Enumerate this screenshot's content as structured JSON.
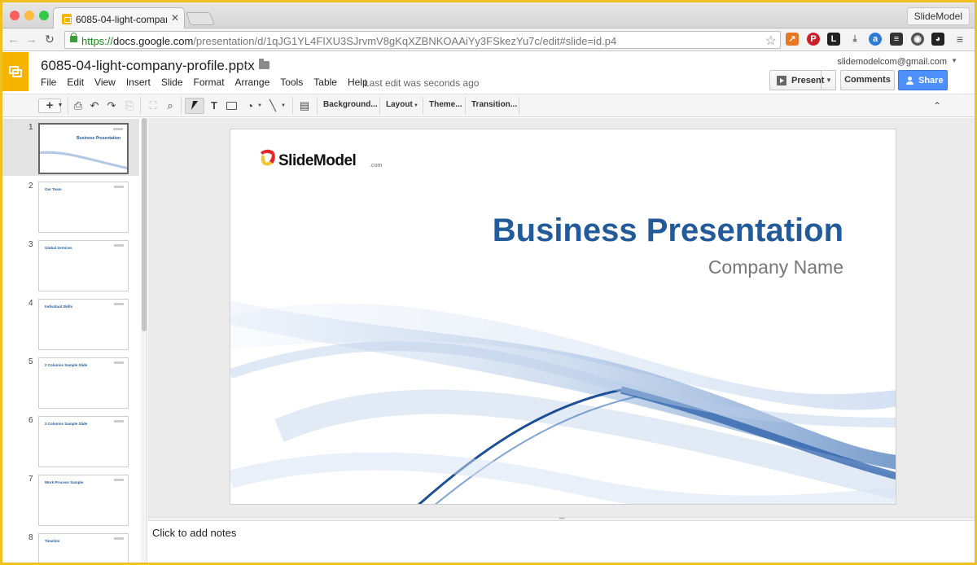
{
  "browser": {
    "tab_title": "6085-04-light-company-pr",
    "profile_name": "SlideModel",
    "url": {
      "scheme": "https://",
      "host": "docs.google.com",
      "path": "/presentation/d/1qJG1YL4FIXU3SJrvmV8gKqXZBNKOAAiYy3FSkezYu7c/edit#slide=id.p4"
    },
    "extensions": [
      "chart-extension-icon",
      "pinterest-icon",
      "l-extension-icon",
      "download-icon",
      "a-extension-icon",
      "buffer-icon",
      "globe-icon",
      "owl-icon",
      "menu-icon"
    ]
  },
  "docs": {
    "file_name": "6085-04-light-company-profile.pptx",
    "account_email": "slidemodelcom@gmail.com",
    "menu": [
      "File",
      "Edit",
      "View",
      "Insert",
      "Slide",
      "Format",
      "Arrange",
      "Tools",
      "Table",
      "Help"
    ],
    "last_edit": "Last edit was seconds ago",
    "present_label": "Present",
    "comments_label": "Comments",
    "share_label": "Share"
  },
  "toolbar": {
    "background_label": "Background...",
    "layout_label": "Layout",
    "theme_label": "Theme...",
    "transition_label": "Transition..."
  },
  "filmstrip": [
    {
      "num": "1",
      "title": "Business Presentation",
      "active": true
    },
    {
      "num": "2",
      "title": "Our Team",
      "active": false
    },
    {
      "num": "3",
      "title": "Global Services",
      "active": false
    },
    {
      "num": "4",
      "title": "Individual Skills",
      "active": false
    },
    {
      "num": "5",
      "title": "2 Columns Sample Slide",
      "active": false
    },
    {
      "num": "6",
      "title": "3 Columns Sample Slide",
      "active": false
    },
    {
      "num": "7",
      "title": "Work Process Sample",
      "active": false
    },
    {
      "num": "8",
      "title": "Timeline",
      "active": false
    }
  ],
  "slide": {
    "logo_text": "SlideModel",
    "logo_suffix": ".com",
    "title": "Business Presentation",
    "subtitle": "Company Name",
    "accent_color": "#235a9a"
  },
  "notes_placeholder": "Click to add notes",
  "colors": {
    "docs_yellow": "#f4b400",
    "share_blue": "#4d90fe",
    "url_green": "#1a8a1a"
  }
}
